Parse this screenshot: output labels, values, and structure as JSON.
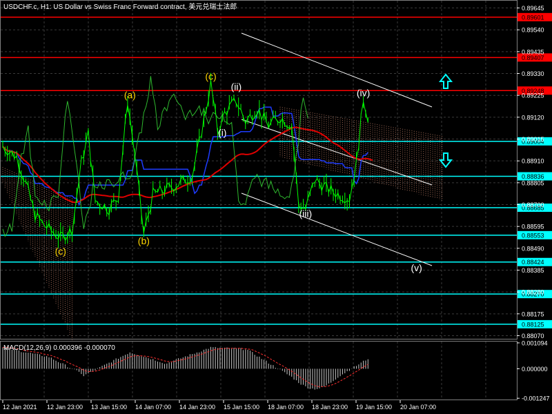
{
  "window": {
    "title": "USDCHF.c, H1:  US Dollar vs Swiss Franc Forward contract, 美元兑瑞士法郎"
  },
  "colors": {
    "background": "#000000",
    "grid": "#3a3a3a",
    "price_line": "#00ff00",
    "ichimoku_kijun": "#1e3cff",
    "moving_average": "#e00000",
    "cloud": "#d08a70",
    "red_level": "#ff0000",
    "cyan_level": "#00ffff",
    "channel": "#ffffff",
    "wave_yellow": "#ffd700",
    "wave_white": "#ffffff",
    "arrow_cyan": "#00ffff",
    "macd_hist": "#c8c8c8",
    "macd_signal": "#ff3030",
    "axis_text": "#ffffff"
  },
  "price_axis": {
    "ticks": [
      "0.89645",
      "0.89540",
      "0.89435",
      "0.89330",
      "0.89225",
      "0.89120",
      "0.89015",
      "0.88910",
      "0.88805",
      "0.88700",
      "0.88595",
      "0.88490",
      "0.88385",
      "0.88280",
      "0.88175",
      "0.88070"
    ],
    "range": [
      0.88055,
      0.8968
    ]
  },
  "levels": {
    "red": [
      {
        "label": "0.89601",
        "value": 0.89601
      },
      {
        "label": "0.89407",
        "value": 0.89407
      },
      {
        "label": "0.89248",
        "value": 0.89248
      }
    ],
    "cyan": [
      {
        "label": "0.89004",
        "value": 0.89004
      },
      {
        "label": "0.88836",
        "value": 0.88836
      },
      {
        "label": "0.88685",
        "value": 0.88685
      },
      {
        "label": "0.88553",
        "value": 0.88553
      },
      {
        "label": "0.88424",
        "value": 0.88424
      },
      {
        "label": "0.88270",
        "value": 0.8827
      },
      {
        "label": "0.88125",
        "value": 0.88125
      }
    ]
  },
  "time_axis": {
    "labels": [
      "12 Jan 2021",
      "12 Jan 23:00",
      "13 Jan 15:00",
      "14 Jan 07:00",
      "14 Jan 23:00",
      "15 Jan 15:00",
      "18 Jan 07:00",
      "18 Jan 23:00",
      "19 Jan 15:00",
      "20 Jan 07:00"
    ]
  },
  "waves": [
    {
      "label": "(a)",
      "color": "yellow",
      "bar": 55,
      "price": 0.8921
    },
    {
      "label": "(b)",
      "color": "yellow",
      "bar": 61,
      "price": 0.8851
    },
    {
      "label": "(c)",
      "color": "yellow",
      "bar": 25,
      "price": 0.8846
    },
    {
      "label": "(c)",
      "color": "yellow",
      "bar": 90,
      "price": 0.893
    },
    {
      "label": "(ii)",
      "color": "white",
      "bar": 101,
      "price": 0.8925
    },
    {
      "label": "(i)",
      "color": "white",
      "bar": 95,
      "price": 0.8903
    },
    {
      "label": "(iii)",
      "color": "white",
      "bar": 131,
      "price": 0.8864
    },
    {
      "label": "(iv)",
      "color": "white",
      "bar": 156,
      "price": 0.8922
    },
    {
      "label": "(v)",
      "color": "white",
      "bar": 179,
      "price": 0.8838
    }
  ],
  "macd": {
    "title": "MACD(12,26,9) 0.000396 -0.000070",
    "ticks": [
      "0.001094",
      "0.000000",
      "-0.001247"
    ],
    "range": [
      -0.0013,
      0.00115
    ]
  }
}
